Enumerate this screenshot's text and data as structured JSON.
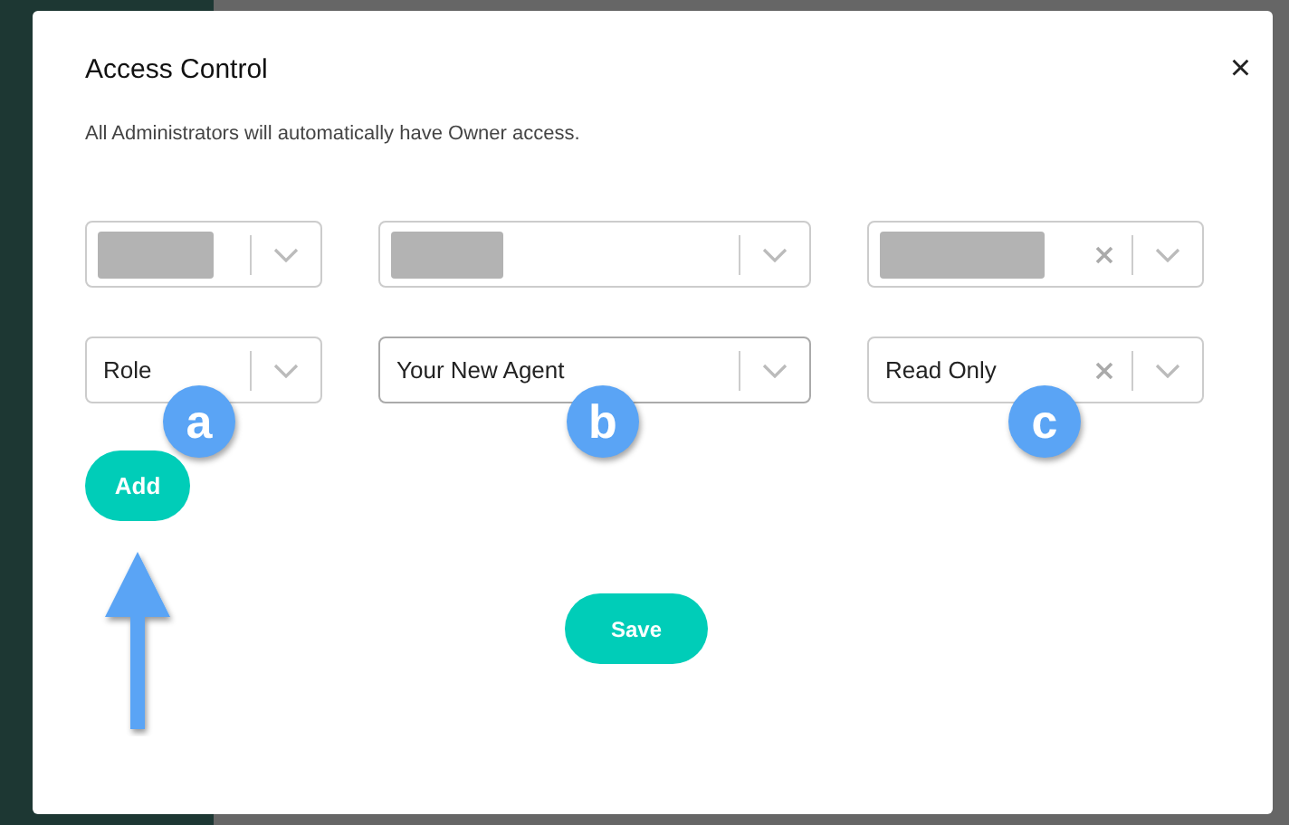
{
  "dialog": {
    "title": "Access Control",
    "close_icon": "×",
    "note": "All Administrators will automatically have Owner access."
  },
  "rows": [
    [
      {
        "kind": "redacted",
        "clearable": false
      },
      {
        "kind": "redacted",
        "clearable": false
      },
      {
        "kind": "redacted",
        "clearable": true
      }
    ],
    [
      {
        "kind": "value",
        "value": "Role",
        "clearable": false,
        "marker": "a"
      },
      {
        "kind": "value",
        "value": "Your New Agent",
        "clearable": false,
        "marker": "b"
      },
      {
        "kind": "value",
        "value": "Read Only",
        "clearable": true,
        "marker": "c"
      }
    ]
  ],
  "add_button": "Add",
  "save_button": "Save"
}
